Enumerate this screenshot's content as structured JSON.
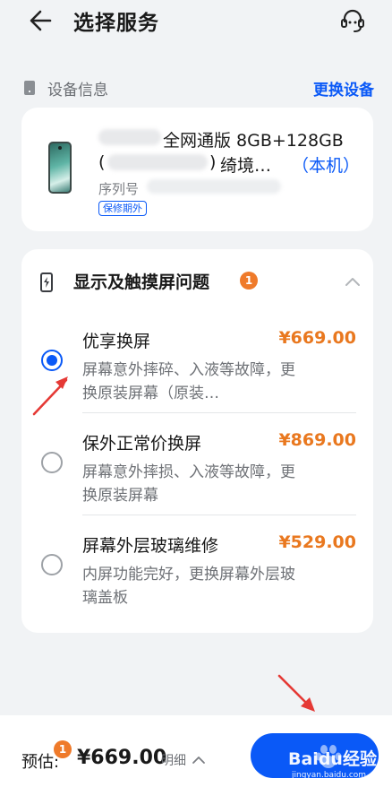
{
  "header": {
    "title": "选择服务"
  },
  "device_section": {
    "label": "设备信息",
    "change_link": "更换设备",
    "device": {
      "name_suffix": "全网通版 8GB+128GB",
      "paren_open": "(",
      "paren_close": ")",
      "variant": "绮境…",
      "this_device": "（本机）",
      "serial_label": "序列号",
      "warranty_badge": "保修期外"
    }
  },
  "category": {
    "title": "显示及触摸屏问题",
    "badge_count": "1",
    "options": [
      {
        "name": "优享换屏",
        "price": "¥669.00",
        "desc": "屏幕意外摔碎、入液等故障，更换原装屏幕（原装…",
        "selected": true
      },
      {
        "name": "保外正常价换屏",
        "price": "¥869.00",
        "desc": "屏幕意外摔损、入液等故障，更换原装屏幕",
        "selected": false
      },
      {
        "name": "屏幕外层玻璃维修",
        "price": "¥529.00",
        "desc": "内屏功能完好，更换屏幕外层玻璃盖板",
        "selected": false
      }
    ]
  },
  "footer": {
    "estimate_label": "预估:",
    "estimate_badge": "1",
    "estimate_price": "¥669.00",
    "detail_label": "明细"
  },
  "watermark": {
    "brand": "Baidu经验",
    "url": "jingyan.baidu.com"
  },
  "colors": {
    "accent": "#0a59f7",
    "price": "#e9781f",
    "badge": "#ef7a2a",
    "annotation": "#e53935"
  }
}
